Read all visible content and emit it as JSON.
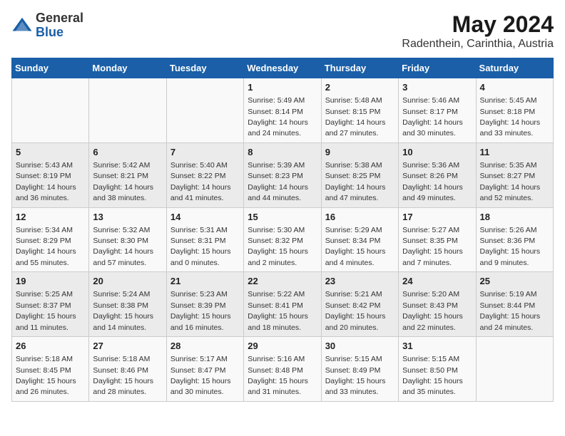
{
  "logo": {
    "general": "General",
    "blue": "Blue"
  },
  "title": "May 2024",
  "subtitle": "Radenthein, Carinthia, Austria",
  "days_of_week": [
    "Sunday",
    "Monday",
    "Tuesday",
    "Wednesday",
    "Thursday",
    "Friday",
    "Saturday"
  ],
  "weeks": [
    [
      {
        "day": "",
        "info": ""
      },
      {
        "day": "",
        "info": ""
      },
      {
        "day": "",
        "info": ""
      },
      {
        "day": "1",
        "info": "Sunrise: 5:49 AM\nSunset: 8:14 PM\nDaylight: 14 hours\nand 24 minutes."
      },
      {
        "day": "2",
        "info": "Sunrise: 5:48 AM\nSunset: 8:15 PM\nDaylight: 14 hours\nand 27 minutes."
      },
      {
        "day": "3",
        "info": "Sunrise: 5:46 AM\nSunset: 8:17 PM\nDaylight: 14 hours\nand 30 minutes."
      },
      {
        "day": "4",
        "info": "Sunrise: 5:45 AM\nSunset: 8:18 PM\nDaylight: 14 hours\nand 33 minutes."
      }
    ],
    [
      {
        "day": "5",
        "info": "Sunrise: 5:43 AM\nSunset: 8:19 PM\nDaylight: 14 hours\nand 36 minutes."
      },
      {
        "day": "6",
        "info": "Sunrise: 5:42 AM\nSunset: 8:21 PM\nDaylight: 14 hours\nand 38 minutes."
      },
      {
        "day": "7",
        "info": "Sunrise: 5:40 AM\nSunset: 8:22 PM\nDaylight: 14 hours\nand 41 minutes."
      },
      {
        "day": "8",
        "info": "Sunrise: 5:39 AM\nSunset: 8:23 PM\nDaylight: 14 hours\nand 44 minutes."
      },
      {
        "day": "9",
        "info": "Sunrise: 5:38 AM\nSunset: 8:25 PM\nDaylight: 14 hours\nand 47 minutes."
      },
      {
        "day": "10",
        "info": "Sunrise: 5:36 AM\nSunset: 8:26 PM\nDaylight: 14 hours\nand 49 minutes."
      },
      {
        "day": "11",
        "info": "Sunrise: 5:35 AM\nSunset: 8:27 PM\nDaylight: 14 hours\nand 52 minutes."
      }
    ],
    [
      {
        "day": "12",
        "info": "Sunrise: 5:34 AM\nSunset: 8:29 PM\nDaylight: 14 hours\nand 55 minutes."
      },
      {
        "day": "13",
        "info": "Sunrise: 5:32 AM\nSunset: 8:30 PM\nDaylight: 14 hours\nand 57 minutes."
      },
      {
        "day": "14",
        "info": "Sunrise: 5:31 AM\nSunset: 8:31 PM\nDaylight: 15 hours\nand 0 minutes."
      },
      {
        "day": "15",
        "info": "Sunrise: 5:30 AM\nSunset: 8:32 PM\nDaylight: 15 hours\nand 2 minutes."
      },
      {
        "day": "16",
        "info": "Sunrise: 5:29 AM\nSunset: 8:34 PM\nDaylight: 15 hours\nand 4 minutes."
      },
      {
        "day": "17",
        "info": "Sunrise: 5:27 AM\nSunset: 8:35 PM\nDaylight: 15 hours\nand 7 minutes."
      },
      {
        "day": "18",
        "info": "Sunrise: 5:26 AM\nSunset: 8:36 PM\nDaylight: 15 hours\nand 9 minutes."
      }
    ],
    [
      {
        "day": "19",
        "info": "Sunrise: 5:25 AM\nSunset: 8:37 PM\nDaylight: 15 hours\nand 11 minutes."
      },
      {
        "day": "20",
        "info": "Sunrise: 5:24 AM\nSunset: 8:38 PM\nDaylight: 15 hours\nand 14 minutes."
      },
      {
        "day": "21",
        "info": "Sunrise: 5:23 AM\nSunset: 8:39 PM\nDaylight: 15 hours\nand 16 minutes."
      },
      {
        "day": "22",
        "info": "Sunrise: 5:22 AM\nSunset: 8:41 PM\nDaylight: 15 hours\nand 18 minutes."
      },
      {
        "day": "23",
        "info": "Sunrise: 5:21 AM\nSunset: 8:42 PM\nDaylight: 15 hours\nand 20 minutes."
      },
      {
        "day": "24",
        "info": "Sunrise: 5:20 AM\nSunset: 8:43 PM\nDaylight: 15 hours\nand 22 minutes."
      },
      {
        "day": "25",
        "info": "Sunrise: 5:19 AM\nSunset: 8:44 PM\nDaylight: 15 hours\nand 24 minutes."
      }
    ],
    [
      {
        "day": "26",
        "info": "Sunrise: 5:18 AM\nSunset: 8:45 PM\nDaylight: 15 hours\nand 26 minutes."
      },
      {
        "day": "27",
        "info": "Sunrise: 5:18 AM\nSunset: 8:46 PM\nDaylight: 15 hours\nand 28 minutes."
      },
      {
        "day": "28",
        "info": "Sunrise: 5:17 AM\nSunset: 8:47 PM\nDaylight: 15 hours\nand 30 minutes."
      },
      {
        "day": "29",
        "info": "Sunrise: 5:16 AM\nSunset: 8:48 PM\nDaylight: 15 hours\nand 31 minutes."
      },
      {
        "day": "30",
        "info": "Sunrise: 5:15 AM\nSunset: 8:49 PM\nDaylight: 15 hours\nand 33 minutes."
      },
      {
        "day": "31",
        "info": "Sunrise: 5:15 AM\nSunset: 8:50 PM\nDaylight: 15 hours\nand 35 minutes."
      },
      {
        "day": "",
        "info": ""
      }
    ]
  ]
}
